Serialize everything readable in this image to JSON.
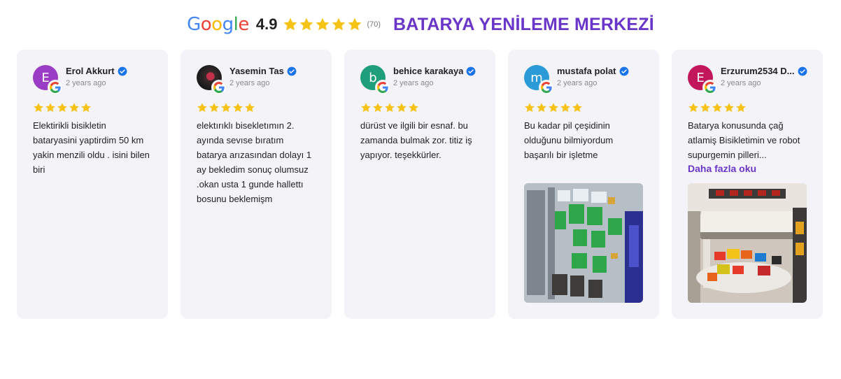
{
  "header": {
    "google_logo_text": "Google",
    "rating": "4.9",
    "star_count": 5,
    "review_count": "(70)",
    "business_name": "BATARYA YENİLEME MERKEZİ",
    "colors": {
      "star": "#f5c315",
      "accent": "#6a35c9"
    }
  },
  "reviews": [
    {
      "initial": "E",
      "avatar_color": "#9b3cc4",
      "name": "Erol Akkurt",
      "date": "2 years ago",
      "stars": 5,
      "text": "Elektirikli bisikletin bataryasini yaptirdim 50 km yakin menzili oldu . isini bilen biri"
    },
    {
      "initial": "",
      "avatar_color": "#2b2b2b",
      "name": "Yasemin Tas",
      "date": "2 years ago",
      "stars": 5,
      "text": "elektırıklı bisekletımın 2. ayında sevıse bıratım batarya arızasından dolayı 1 ay bekledim sonuç olumsuz .okan usta 1 gunde hallettı bosunu beklemişm"
    },
    {
      "initial": "b",
      "avatar_color": "#1e9e7a",
      "name": "behice karakaya",
      "date": "2 years ago",
      "stars": 5,
      "text": "dürüst ve ilgili bir esnaf. bu zamanda bulmak zor. titiz iş yapıyor. teşekkürler."
    },
    {
      "initial": "m",
      "avatar_color": "#2a9bd6",
      "name": "mustafa polat",
      "date": "2 years ago",
      "stars": 5,
      "text": "Bu kadar pil çeşidinin olduğunu bilmiyordum başarılı bir işletme",
      "photo_alt": "battery display rack"
    },
    {
      "initial": "E",
      "avatar_color": "#c2185b",
      "name": "Erzurum2534 D...",
      "date": "2 years ago",
      "stars": 5,
      "text": "Batarya konusunda çağ atlamiş Bisikletimin ve robot supurgemin pilleri...",
      "more_label": "Daha fazla oku",
      "photo_alt": "battery shop interior"
    }
  ]
}
